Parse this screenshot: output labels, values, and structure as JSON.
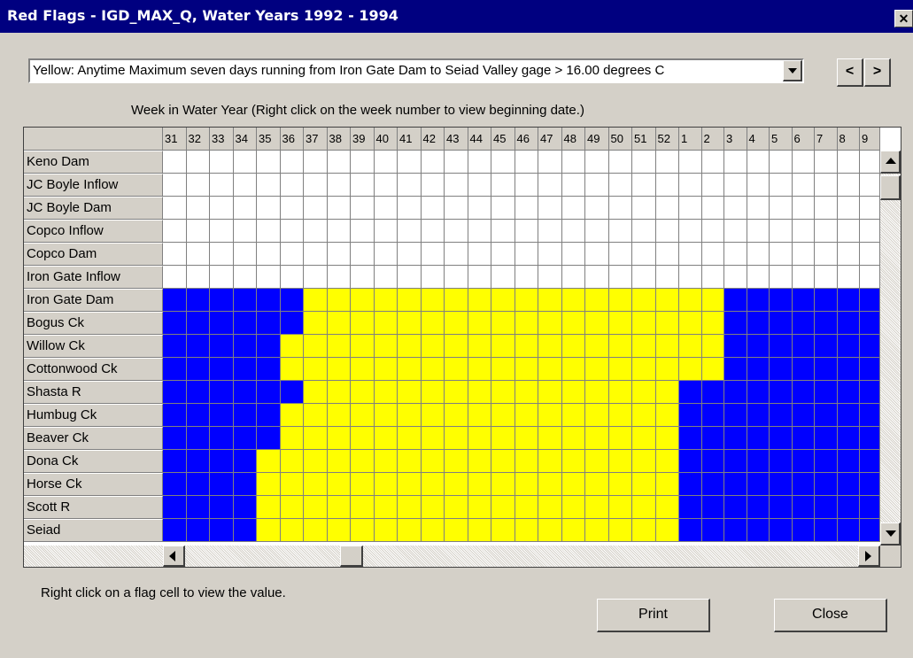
{
  "window": {
    "title": "Red Flags - IGD_MAX_Q, Water Years 1992 - 1994",
    "close_glyph": "✕"
  },
  "criterion": {
    "selected": "Yellow: Anytime Maximum seven days running from Iron Gate Dam to Seiad Valley gage >  16.00 degrees C"
  },
  "nav": {
    "prev": "<",
    "next": ">"
  },
  "grid": {
    "caption": "Week in Water Year  (Right click on the week number to view beginning date.)",
    "weeks": [
      "31",
      "32",
      "33",
      "34",
      "35",
      "36",
      "37",
      "38",
      "39",
      "40",
      "41",
      "42",
      "43",
      "44",
      "45",
      "46",
      "47",
      "48",
      "49",
      "50",
      "51",
      "52",
      "1",
      "2",
      "3",
      "4",
      "5",
      "6",
      "7",
      "8",
      "9"
    ],
    "locations": [
      "Keno Dam",
      "JC Boyle Inflow",
      "JC Boyle Dam",
      "Copco Inflow",
      "Copco Dam",
      "Iron Gate Inflow",
      "Iron Gate Dam",
      "Bogus Ck",
      "Willow Ck",
      "Cottonwood Ck",
      "Shasta R",
      "Humbug Ck",
      "Beaver Ck",
      "Dona Ck",
      "Horse Ck",
      "Scott R",
      "Seiad"
    ],
    "flag_colors": {
      "W": "#ffffff",
      "B": "#0000ff",
      "Y": "#ffff00"
    },
    "flags": [
      "WWWWWWWWWWWWWWWWWWWWWWWWWWWWWWW",
      "WWWWWWWWWWWWWWWWWWWWWWWWWWWWWWW",
      "WWWWWWWWWWWWWWWWWWWWWWWWWWWWWWW",
      "WWWWWWWWWWWWWWWWWWWWWWWWWWWWWWW",
      "WWWWWWWWWWWWWWWWWWWWWWWWWWWWWWW",
      "WWWWWWWWWWWWWWWWWWWWWWWWWWWWWWW",
      "BBBBBBYYYYYYYYYYYYYYYYYYBBBBBBB",
      "BBBBBBYYYYYYYYYYYYYYYYYYBBBBBBB",
      "BBBBBYYYYYYYYYYYYYYYYYYYBBBBBBB",
      "BBBBBYYYYYYYYYYYYYYYYYYYBBBBBBB",
      "BBBBBBYYYYYYYYYYYYYYYYBBBBBBBBB",
      "BBBBBYYYYYYYYYYYYYYYYYBBBBBBBBB",
      "BBBBBYYYYYYYYYYYYYYYYYBBBBBBBBB",
      "BBBBYYYYYYYYYYYYYYYYYYBBBBBBBBB",
      "BBBBYYYYYYYYYYYYYYYYYYBBBBBBBBB",
      "BBBBYYYYYYYYYYYYYYYYYYBBBBBBBBB",
      "BBBBYYYYYYYYYYYYYYYYYYBBBBBBBBB"
    ]
  },
  "footer": {
    "hint": "Right click on a flag cell to view the value.",
    "print_label": "Print",
    "close_label": "Close"
  }
}
